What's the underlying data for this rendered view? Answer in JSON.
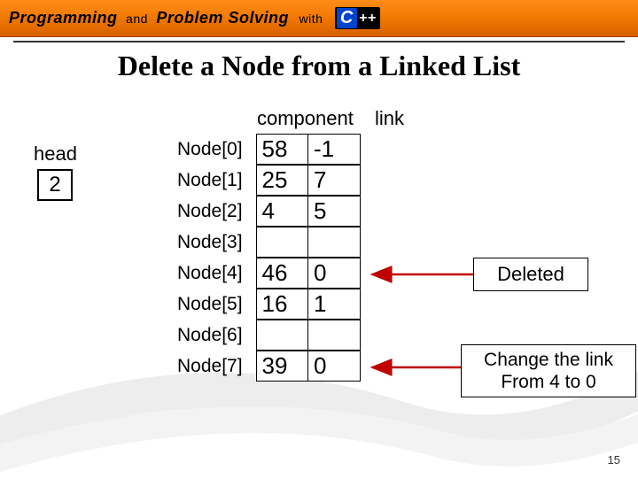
{
  "header": {
    "word1": "Programming",
    "and": "and",
    "word2": "Problem Solving",
    "with": "with",
    "logo_c": "C",
    "logo_plus": "++"
  },
  "title": "Delete a Node from a Linked List",
  "head_label": "head",
  "head_value": "2",
  "col_component": "component",
  "col_link": "link",
  "nodes": [
    {
      "label": "Node[0]",
      "component": "58",
      "link": "-1"
    },
    {
      "label": "Node[1]",
      "component": "25",
      "link": "7"
    },
    {
      "label": "Node[2]",
      "component": "4",
      "link": "5"
    },
    {
      "label": "Node[3]",
      "component": "",
      "link": ""
    },
    {
      "label": "Node[4]",
      "component": "46",
      "link": "0"
    },
    {
      "label": "Node[5]",
      "component": "16",
      "link": "1"
    },
    {
      "label": "Node[6]",
      "component": "",
      "link": ""
    },
    {
      "label": "Node[7]",
      "component": "39",
      "link": "0"
    }
  ],
  "deleted_label": "Deleted",
  "change_label": "Change the link\nFrom 4 to 0",
  "slide_number": "15"
}
